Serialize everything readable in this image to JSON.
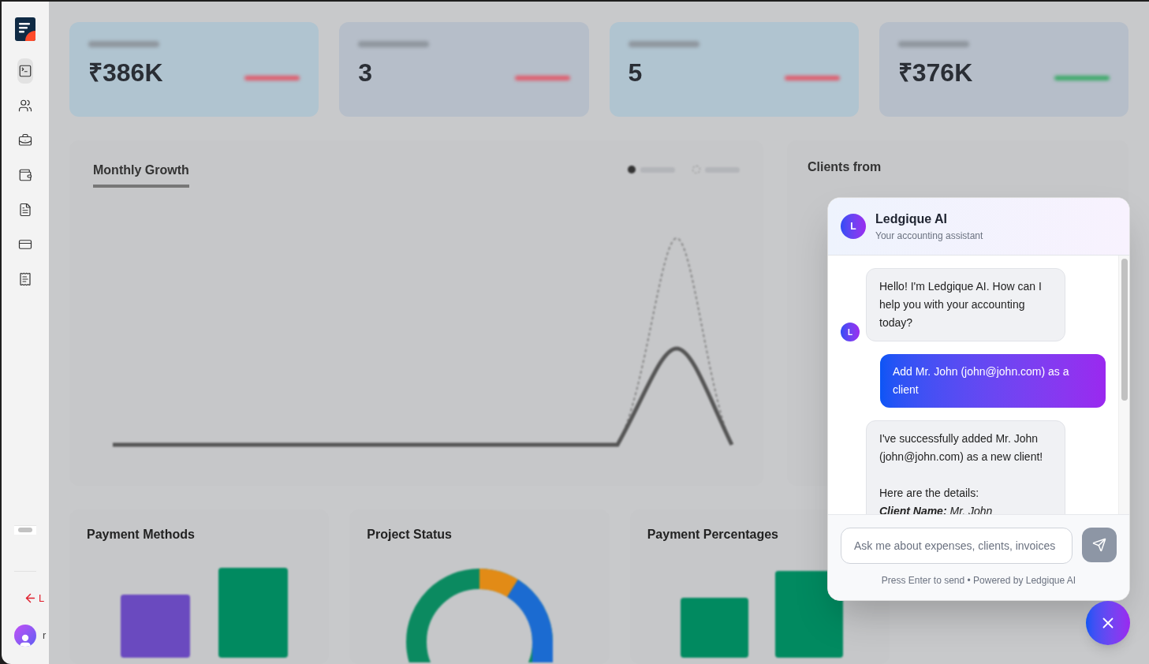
{
  "sidebar": {
    "nav": [
      {
        "kind": "terminal",
        "selected": true
      },
      {
        "kind": "users",
        "selected": false
      },
      {
        "kind": "briefcase",
        "selected": false
      },
      {
        "kind": "wallet",
        "selected": false
      },
      {
        "kind": "file",
        "selected": false
      },
      {
        "kind": "card",
        "selected": false
      },
      {
        "kind": "receipt",
        "selected": false
      }
    ],
    "logout": {
      "label": "L"
    },
    "user": {
      "name": "r"
    }
  },
  "stats": [
    {
      "value": "₹386K",
      "color": "#b0c4d0",
      "kind": "down"
    },
    {
      "value": "3",
      "color": "#b6bec9",
      "kind": "down"
    },
    {
      "value": "5",
      "color": "#b0c4d0",
      "kind": "down"
    },
    {
      "value": "₹376K",
      "color": "#b6bec9",
      "kind": "up"
    }
  ],
  "growth": {
    "title": "Monthly Growth",
    "legend": [
      {
        "kind": "solid"
      },
      {
        "kind": "dashed"
      }
    ]
  },
  "clients_from": {
    "title": "Clients from"
  },
  "bottom_panels": [
    {
      "title": "Payment Methods",
      "kind": "bars"
    },
    {
      "title": "Project Status",
      "kind": "donut"
    },
    {
      "title": "Payment Percentages",
      "kind": "bars2"
    }
  ],
  "chat": {
    "title": "Ledgique AI",
    "subtitle": "Your accounting assistant",
    "avatar": "L",
    "messages": [
      {
        "kind": "bot",
        "avatar": "L",
        "lines": [
          {
            "text": "Hello! I'm Ledgique AI. How can I help you with your accounting today?",
            "kind": "para"
          }
        ]
      },
      {
        "kind": "user",
        "lines": [
          {
            "text": "Add Mr. John (john@john.com) as a client",
            "kind": "para"
          }
        ]
      },
      {
        "kind": "bot",
        "lines": [
          {
            "text": "I've successfully added Mr. John (john@john.com) as a new client!",
            "kind": "para"
          },
          {
            "text": "Here are the details:",
            "kind": "para"
          },
          {
            "text": "**Client Name:** Mr. John",
            "kind": "detail"
          }
        ]
      }
    ],
    "input": {
      "placeholder": "Ask me about expenses, clients, invoices"
    },
    "footer": "Press Enter to send • Powered by Ledgique AI"
  }
}
